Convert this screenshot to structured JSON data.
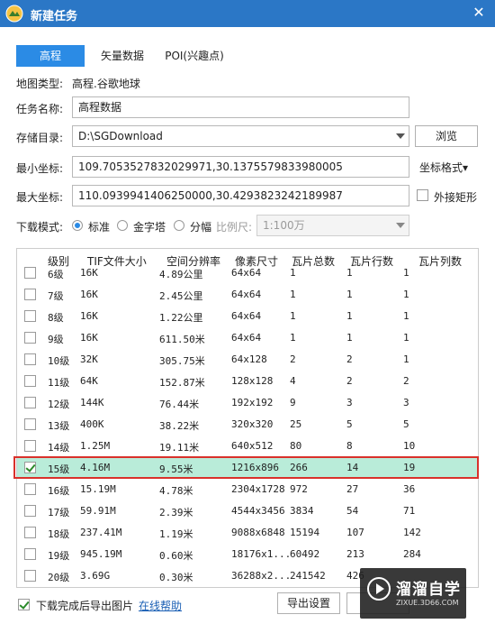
{
  "window": {
    "title": "新建任务",
    "close_label": "✕"
  },
  "tabs": [
    {
      "label": "高程",
      "active": true
    },
    {
      "label": "矢量数据",
      "active": false
    },
    {
      "label": "POI(兴趣点)",
      "active": false
    }
  ],
  "map_type": {
    "label": "地图类型:",
    "value": "高程.谷歌地球"
  },
  "task_name": {
    "label": "任务名称:",
    "value": "高程数据"
  },
  "storage": {
    "label": "存储目录:",
    "value": "D:\\SGDownload",
    "browse_label": "浏览"
  },
  "min_coord": {
    "label": "最小坐标:",
    "value": "109.7053527832029971,30.1375579833980005",
    "format_label": "坐标格式▾"
  },
  "max_coord": {
    "label": "最大坐标:",
    "value": "110.0939941406250000,30.4293823242189987",
    "bbox_label": "外接矩形",
    "bbox_checked": false
  },
  "download_mode": {
    "label": "下载模式:",
    "options": [
      {
        "label": "标准",
        "selected": true,
        "enabled": true
      },
      {
        "label": "金字塔",
        "selected": false,
        "enabled": true
      },
      {
        "label": "分幅",
        "selected": false,
        "enabled": true
      }
    ],
    "scale_label": "比例尺:",
    "scale_value": "1:100万"
  },
  "table": {
    "headers": [
      "级别",
      "TIF文件大小",
      "空间分辨率",
      "像素尺寸",
      "瓦片总数",
      "瓦片行数",
      "瓦片列数"
    ],
    "rows": [
      {
        "checked": false,
        "level": "6级",
        "size": "16K",
        "resolution": "4.89公里",
        "pixels": "64x64",
        "total": "1",
        "rows": "1",
        "cols": "1"
      },
      {
        "checked": false,
        "level": "7级",
        "size": "16K",
        "resolution": "2.45公里",
        "pixels": "64x64",
        "total": "1",
        "rows": "1",
        "cols": "1"
      },
      {
        "checked": false,
        "level": "8级",
        "size": "16K",
        "resolution": "1.22公里",
        "pixels": "64x64",
        "total": "1",
        "rows": "1",
        "cols": "1"
      },
      {
        "checked": false,
        "level": "9级",
        "size": "16K",
        "resolution": "611.50米",
        "pixels": "64x64",
        "total": "1",
        "rows": "1",
        "cols": "1"
      },
      {
        "checked": false,
        "level": "10级",
        "size": "32K",
        "resolution": "305.75米",
        "pixels": "64x128",
        "total": "2",
        "rows": "2",
        "cols": "1"
      },
      {
        "checked": false,
        "level": "11级",
        "size": "64K",
        "resolution": "152.87米",
        "pixels": "128x128",
        "total": "4",
        "rows": "2",
        "cols": "2"
      },
      {
        "checked": false,
        "level": "12级",
        "size": "144K",
        "resolution": "76.44米",
        "pixels": "192x192",
        "total": "9",
        "rows": "3",
        "cols": "3"
      },
      {
        "checked": false,
        "level": "13级",
        "size": "400K",
        "resolution": "38.22米",
        "pixels": "320x320",
        "total": "25",
        "rows": "5",
        "cols": "5"
      },
      {
        "checked": false,
        "level": "14级",
        "size": "1.25M",
        "resolution": "19.11米",
        "pixels": "640x512",
        "total": "80",
        "rows": "8",
        "cols": "10"
      },
      {
        "checked": true,
        "level": "15级",
        "size": "4.16M",
        "resolution": "9.55米",
        "pixels": "1216x896",
        "total": "266",
        "rows": "14",
        "cols": "19"
      },
      {
        "checked": false,
        "level": "16级",
        "size": "15.19M",
        "resolution": "4.78米",
        "pixels": "2304x1728",
        "total": "972",
        "rows": "27",
        "cols": "36"
      },
      {
        "checked": false,
        "level": "17级",
        "size": "59.91M",
        "resolution": "2.39米",
        "pixels": "4544x3456",
        "total": "3834",
        "rows": "54",
        "cols": "71"
      },
      {
        "checked": false,
        "level": "18级",
        "size": "237.41M",
        "resolution": "1.19米",
        "pixels": "9088x6848",
        "total": "15194",
        "rows": "107",
        "cols": "142"
      },
      {
        "checked": false,
        "level": "19级",
        "size": "945.19M",
        "resolution": "0.60米",
        "pixels": "18176x1...",
        "total": "60492",
        "rows": "213",
        "cols": "284"
      },
      {
        "checked": false,
        "level": "20级",
        "size": "3.69G",
        "resolution": "0.30米",
        "pixels": "36288x2...",
        "total": "241542",
        "rows": "426",
        "cols": ""
      }
    ]
  },
  "footer": {
    "export_images_label": "下载完成后导出图片",
    "export_images_checked": true,
    "help_link": "在线帮助",
    "export_settings_label": "导出设置",
    "ok_label": ""
  },
  "watermark": {
    "name": "溜溜自学",
    "url": "ZIXUE.3D66.COM"
  },
  "colors": {
    "titlebar": "#2b77c6",
    "accent": "#2b8be5",
    "selected_row": "#b9ecd9",
    "highlight_border": "#d9312b"
  }
}
